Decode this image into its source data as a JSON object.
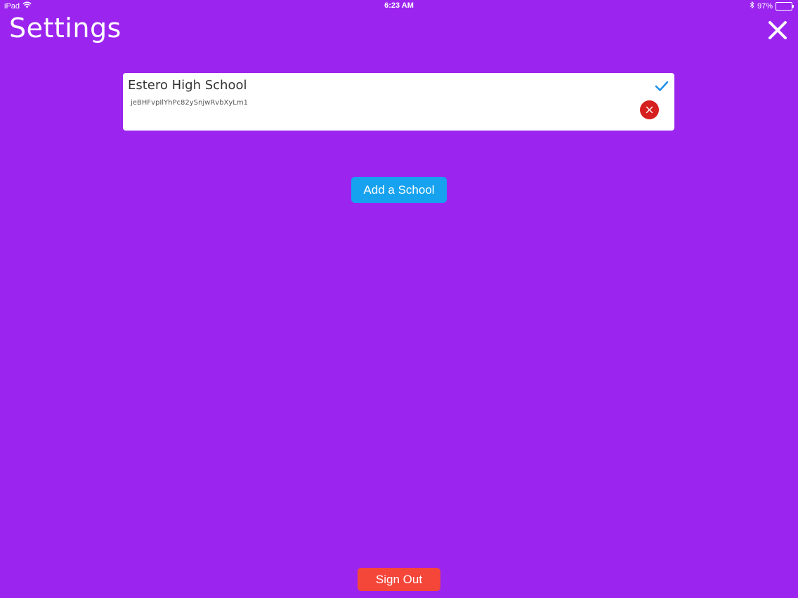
{
  "status_bar": {
    "device": "iPad",
    "time": "6:23 AM",
    "battery": "97%",
    "battery_level": 0.97,
    "icons": [
      "wifi-icon",
      "bluetooth-icon",
      "battery-icon"
    ]
  },
  "header": {
    "title": "Settings",
    "close_icon": "close-icon"
  },
  "schools": [
    {
      "name": "Estero High School",
      "code": "jeBHFvpIlYhPc82ySnjwRvbXyLm1",
      "selected": true,
      "check_icon": "checkmark-icon",
      "remove_icon": "remove-icon"
    }
  ],
  "actions": {
    "add_school_label": "Add a School",
    "sign_out_label": "Sign Out"
  },
  "colors": {
    "background": "#9b25ef",
    "card": "#ffffff",
    "add_button": "#16a2ef",
    "sign_out_button": "#f5463a",
    "remove_button": "#d61f1f",
    "checkmark": "#1e90e8"
  }
}
